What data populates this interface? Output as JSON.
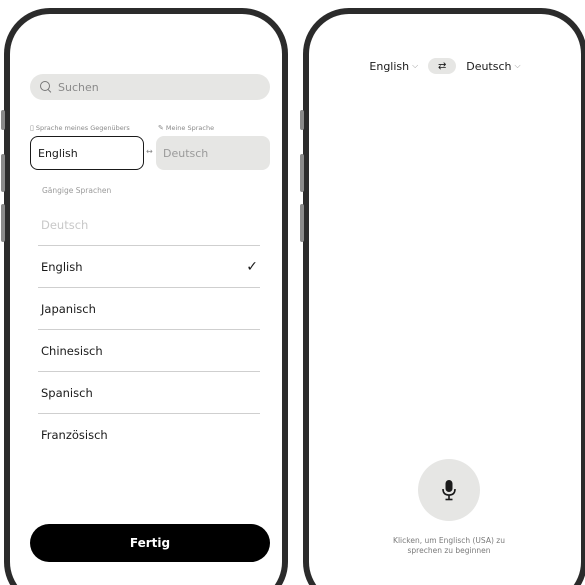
{
  "left_screen": {
    "search": {
      "placeholder": "Suchen"
    },
    "label_other": "Sprache meines Gegenübers",
    "label_mine": "Meine Sprache",
    "other_language": "English",
    "my_language": "Deutsch",
    "section_title": "Gängige Sprachen",
    "languages": [
      {
        "label": "Deutsch",
        "state": "disabled"
      },
      {
        "label": "English",
        "state": "selected"
      },
      {
        "label": "Japanisch",
        "state": "normal"
      },
      {
        "label": "Chinesisch",
        "state": "normal"
      },
      {
        "label": "Spanisch",
        "state": "normal"
      },
      {
        "label": "Französisch",
        "state": "normal"
      }
    ],
    "done_label": "Fertig"
  },
  "right_screen": {
    "source_language": "English",
    "target_language": "Deutsch",
    "hint_line1": "Klicken, um Englisch (USA) zu",
    "hint_line2": "sprechen zu beginnen"
  },
  "icons": {
    "search": "search-icon",
    "check": "checkmark-icon",
    "swap": "swap-icon",
    "mic": "microphone-icon",
    "chevron": "chevron-down-icon"
  },
  "colors": {
    "accent": "#000000",
    "field_bg": "#e6e6e4",
    "frame": "#2b2b2b"
  }
}
